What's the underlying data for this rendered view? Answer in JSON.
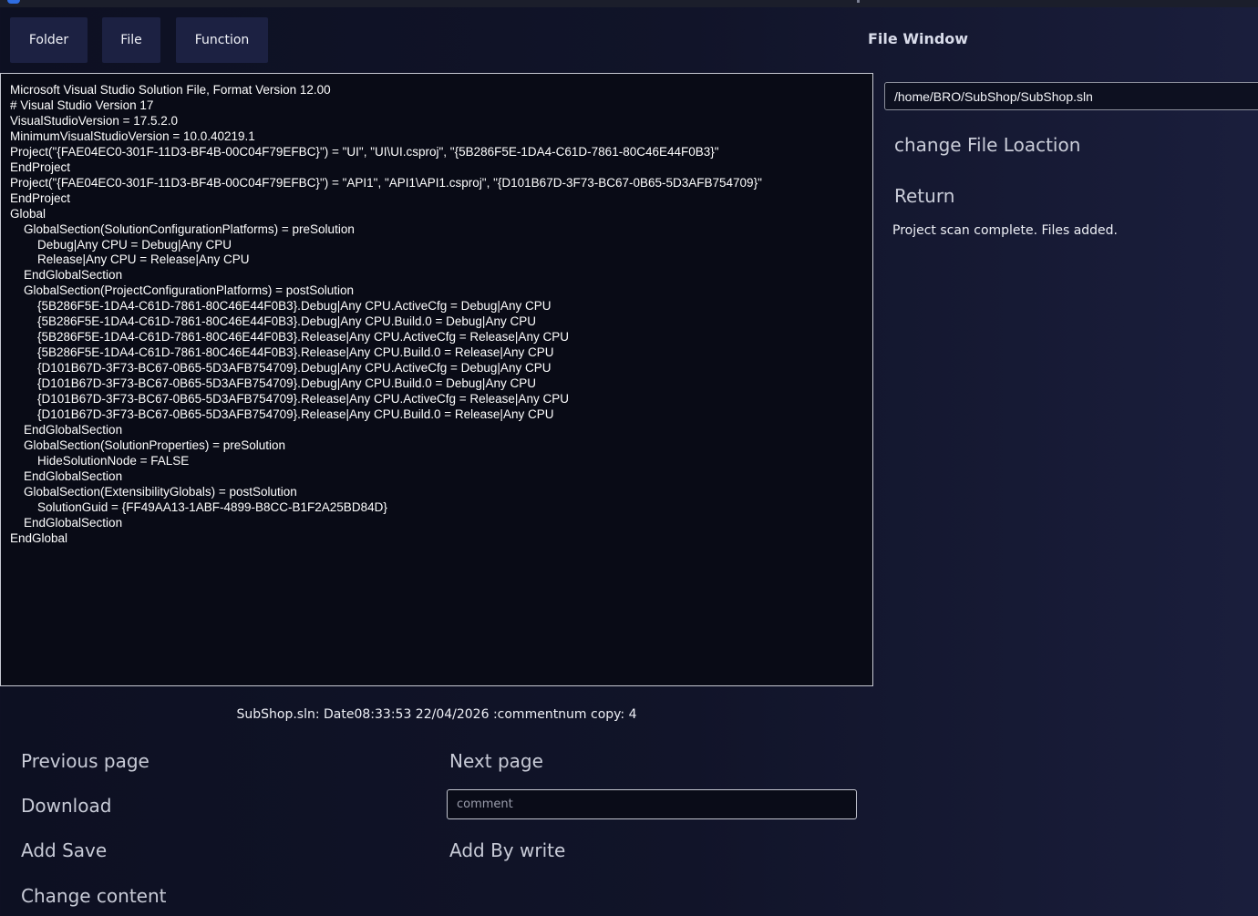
{
  "toolbar": {
    "folder_label": "Folder",
    "file_label": "File",
    "function_label": "Function"
  },
  "file_window": {
    "title": "File Window",
    "path_value": "/home/BRO/SubShop/SubShop.sln",
    "change_location_label": "change File Loaction",
    "return_label": "Return",
    "status": "Project scan complete. Files added."
  },
  "editor": {
    "content": "Microsoft Visual Studio Solution File, Format Version 12.00\n# Visual Studio Version 17\nVisualStudioVersion = 17.5.2.0\nMinimumVisualStudioVersion = 10.0.40219.1\nProject(\"{FAE04EC0-301F-11D3-BF4B-00C04F79EFBC}\") = \"UI\", \"UI\\UI.csproj\", \"{5B286F5E-1DA4-C61D-7861-80C46E44F0B3}\"\nEndProject\nProject(\"{FAE04EC0-301F-11D3-BF4B-00C04F79EFBC}\") = \"API1\", \"API1\\API1.csproj\", \"{D101B67D-3F73-BC67-0B65-5D3AFB754709}\"\nEndProject\nGlobal\n    GlobalSection(SolutionConfigurationPlatforms) = preSolution\n        Debug|Any CPU = Debug|Any CPU\n        Release|Any CPU = Release|Any CPU\n    EndGlobalSection\n    GlobalSection(ProjectConfigurationPlatforms) = postSolution\n        {5B286F5E-1DA4-C61D-7861-80C46E44F0B3}.Debug|Any CPU.ActiveCfg = Debug|Any CPU\n        {5B286F5E-1DA4-C61D-7861-80C46E44F0B3}.Debug|Any CPU.Build.0 = Debug|Any CPU\n        {5B286F5E-1DA4-C61D-7861-80C46E44F0B3}.Release|Any CPU.ActiveCfg = Release|Any CPU\n        {5B286F5E-1DA4-C61D-7861-80C46E44F0B3}.Release|Any CPU.Build.0 = Release|Any CPU\n        {D101B67D-3F73-BC67-0B65-5D3AFB754709}.Debug|Any CPU.ActiveCfg = Debug|Any CPU\n        {D101B67D-3F73-BC67-0B65-5D3AFB754709}.Debug|Any CPU.Build.0 = Debug|Any CPU\n        {D101B67D-3F73-BC67-0B65-5D3AFB754709}.Release|Any CPU.ActiveCfg = Release|Any CPU\n        {D101B67D-3F73-BC67-0B65-5D3AFB754709}.Release|Any CPU.Build.0 = Release|Any CPU\n    EndGlobalSection\n    GlobalSection(SolutionProperties) = preSolution\n        HideSolutionNode = FALSE\n    EndGlobalSection\n    GlobalSection(ExtensibilityGlobals) = postSolution\n        SolutionGuid = {FF49AA13-1ABF-4899-B8CC-B1F2A25BD84D}\n    EndGlobalSection\nEndGlobal"
  },
  "file_info": "SubShop.sln: Date08:33:53 22/04/2026 :commentnum copy: 4",
  "actions": {
    "previous_page": "Previous page",
    "next_page": "Next page",
    "download": "Download",
    "comment_placeholder": "comment",
    "add_save": "Add Save",
    "add_by_write": "Add By write",
    "change_content": "Change content"
  },
  "colors": {
    "background": "#111429",
    "button_bg": "#1c2142",
    "editor_bg": "#090b16",
    "accent": "#2f6de1"
  }
}
